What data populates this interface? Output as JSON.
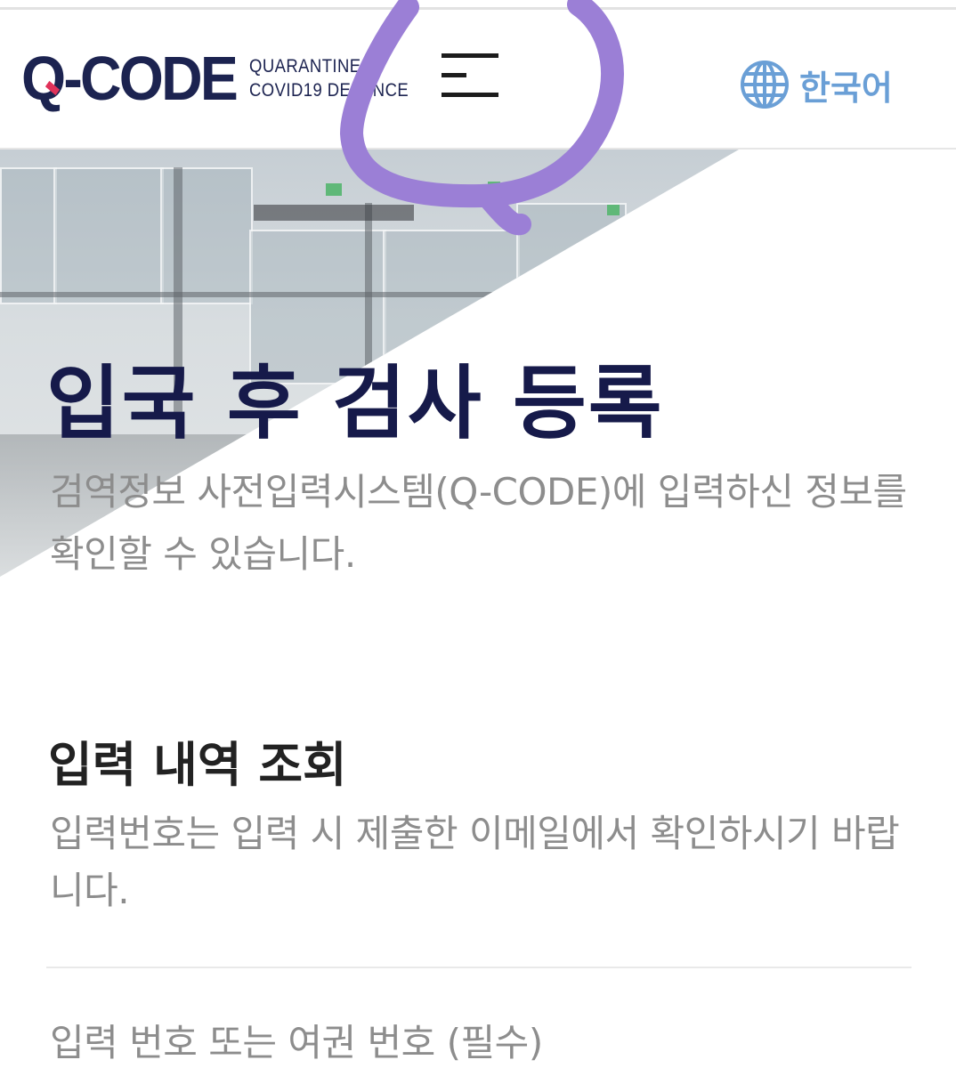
{
  "header": {
    "logo_text": "Q-CODE",
    "logo_sub_line1": "QUARANTINE",
    "logo_sub_line2": "COVID19 DEFENCE",
    "menu_icon": "hamburger-menu-icon",
    "language_icon": "globe-icon",
    "language_label": "한국어"
  },
  "hero": {
    "title": "입국 후 검사 등록",
    "description": "검역정보 사전입력시스템(Q-CODE)에 입력하신 정보를 확인할 수 있습니다."
  },
  "lookup": {
    "title": "입력 내역 조회",
    "description": "입력번호는 입력 시 제출한 이메일에서 확인하시기 바랍니다.",
    "field_label": "입력 번호 또는 여권 번호 (필수)"
  },
  "colors": {
    "brand_navy": "#1c2350",
    "brand_pink": "#e0325a",
    "language_blue": "#6a9fd6",
    "annotation_purple": "#9b7fd6"
  }
}
